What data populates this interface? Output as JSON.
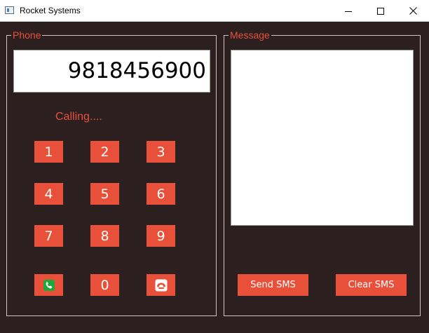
{
  "window": {
    "title": "Rocket Systems",
    "controls": [
      "minimize-icon",
      "maximize-icon",
      "close-icon"
    ]
  },
  "phone": {
    "legend": "Phone",
    "number": "9818456900",
    "status": "Calling....",
    "keys": [
      "1",
      "2",
      "3",
      "4",
      "5",
      "6",
      "7",
      "8",
      "9",
      "0"
    ],
    "call_icon": "phone-call-icon",
    "hangup_icon": "phone-hangup-icon"
  },
  "message": {
    "legend": "Message",
    "text": "",
    "send_label": "Send SMS",
    "clear_label": "Clear SMS"
  },
  "colors": {
    "accent": "#e8503a",
    "background": "#2b1f1f",
    "call_green": "#1fa83a",
    "border": "#cfc4c4"
  }
}
